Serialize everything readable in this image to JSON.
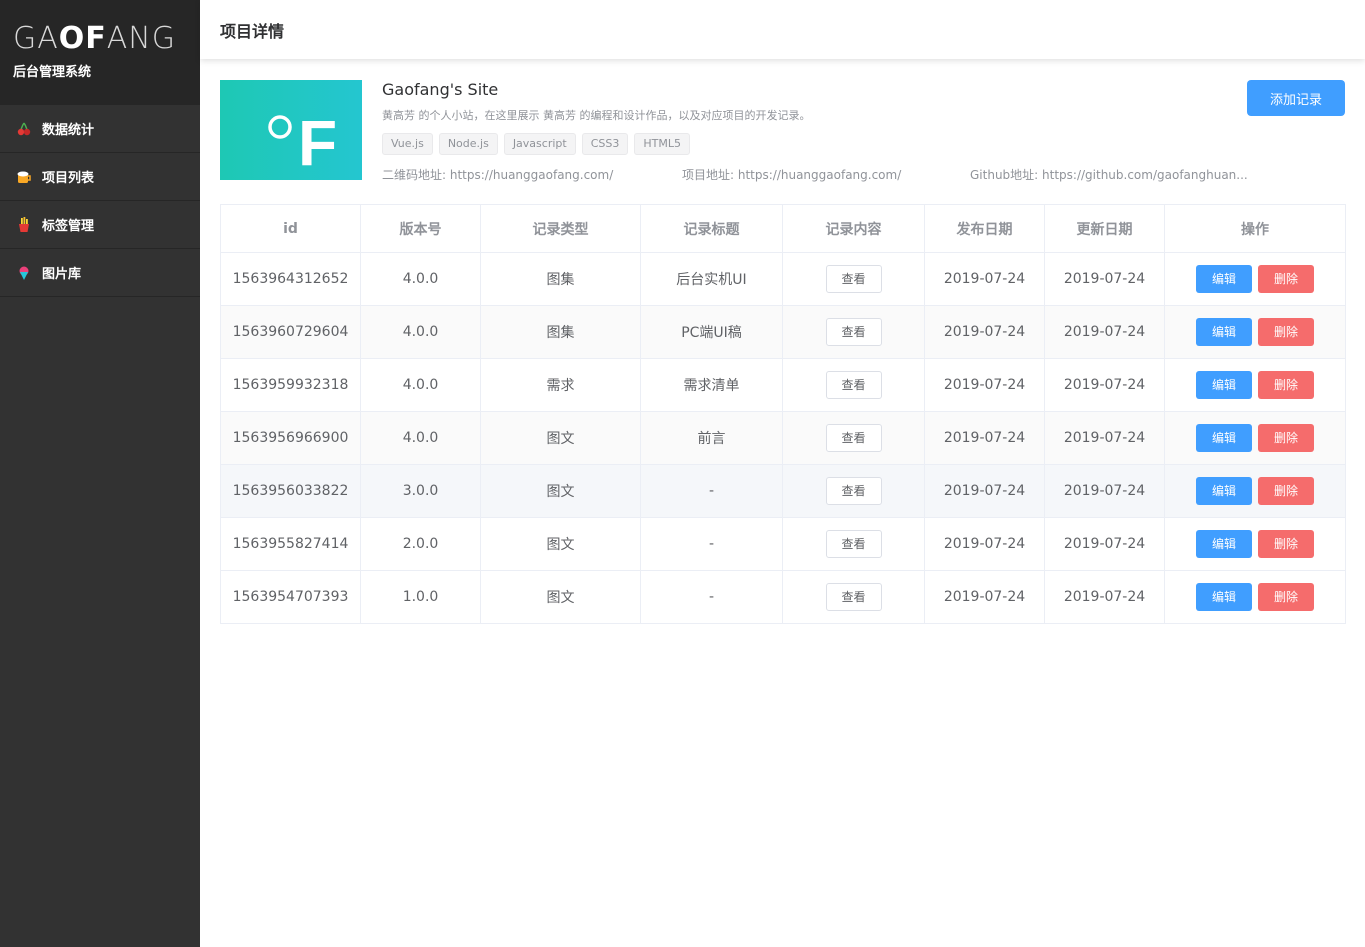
{
  "brand": {
    "logo_pre": "GA",
    "logo_bold": "OF",
    "logo_post": "ANG",
    "subtitle": "后台管理系统"
  },
  "sidebar": {
    "items": [
      {
        "label": "数据统计",
        "icon": "cherry-icon"
      },
      {
        "label": "项目列表",
        "icon": "beer-icon"
      },
      {
        "label": "标签管理",
        "icon": "fries-icon"
      },
      {
        "label": "图片库",
        "icon": "icecream-icon"
      }
    ]
  },
  "header": {
    "title": "项目详情"
  },
  "project": {
    "logo_text": "F",
    "name": "Gaofang's Site",
    "description": "黄高芳 的个人小站，在这里展示 黄高芳 的编程和设计作品，以及对应项目的开发记录。",
    "tags": [
      "Vue.js",
      "Node.js",
      "Javascript",
      "CSS3",
      "HTML5"
    ],
    "qr_address": "二维码地址: https://huanggaofang.com/",
    "project_address": "项目地址: https://huanggaofang.com/",
    "github_address": "Github地址: https://github.com/gaofanghuan...",
    "add_button": "添加记录"
  },
  "table": {
    "columns": [
      "id",
      "版本号",
      "记录类型",
      "记录标题",
      "记录内容",
      "发布日期",
      "更新日期",
      "操作"
    ],
    "view_label": "查看",
    "edit_label": "编辑",
    "delete_label": "删除",
    "rows": [
      {
        "id": "1563964312652",
        "version": "4.0.0",
        "type": "图集",
        "title": "后台实机UI",
        "published": "2019-07-24",
        "updated": "2019-07-24"
      },
      {
        "id": "1563960729604",
        "version": "4.0.0",
        "type": "图集",
        "title": "PC端UI稿",
        "published": "2019-07-24",
        "updated": "2019-07-24"
      },
      {
        "id": "1563959932318",
        "version": "4.0.0",
        "type": "需求",
        "title": "需求清单",
        "published": "2019-07-24",
        "updated": "2019-07-24"
      },
      {
        "id": "1563956966900",
        "version": "4.0.0",
        "type": "图文",
        "title": "前言",
        "published": "2019-07-24",
        "updated": "2019-07-24"
      },
      {
        "id": "1563956033822",
        "version": "3.0.0",
        "type": "图文",
        "title": "-",
        "published": "2019-07-24",
        "updated": "2019-07-24"
      },
      {
        "id": "1563955827414",
        "version": "2.0.0",
        "type": "图文",
        "title": "-",
        "published": "2019-07-24",
        "updated": "2019-07-24"
      },
      {
        "id": "1563954707393",
        "version": "1.0.0",
        "type": "图文",
        "title": "-",
        "published": "2019-07-24",
        "updated": "2019-07-24"
      }
    ]
  },
  "colors": {
    "sidebar_bg": "#323232",
    "brand_bg": "#262626",
    "primary": "#409eff",
    "danger": "#f56c6c",
    "project_logo": "#1ec8b4"
  }
}
